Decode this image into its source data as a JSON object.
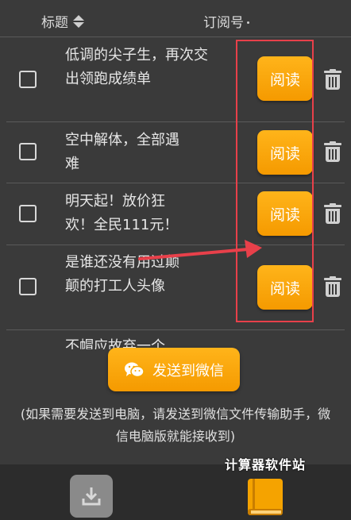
{
  "header": {
    "title_label": "标题",
    "subscription_label": "订阅号"
  },
  "articles": [
    {
      "title": "低调的尖子生，再次交出领跑成绩单",
      "read_label": "阅读"
    },
    {
      "title": "空中解体，全部遇难",
      "read_label": "阅读"
    },
    {
      "title": "明天起！放价狂欢！全民111元！",
      "read_label": "阅读"
    },
    {
      "title": "是谁还没有用过颠颠的打工人头像",
      "read_label": "阅读"
    }
  ],
  "partial_article_title": "不帽应故弃一个",
  "send_button_label": "发送到微信",
  "note": "(如果需要发送到电脑，请发送到微信文件传输助手，微信电脑版就能接收到)",
  "watermark": "计算器软件站",
  "colors": {
    "accent": "#f5a300",
    "highlight": "#e8404a",
    "background": "#3a3a3a"
  },
  "icons": [
    "sort-icon",
    "trash-icon",
    "wechat-icon",
    "download-icon",
    "book-icon"
  ]
}
